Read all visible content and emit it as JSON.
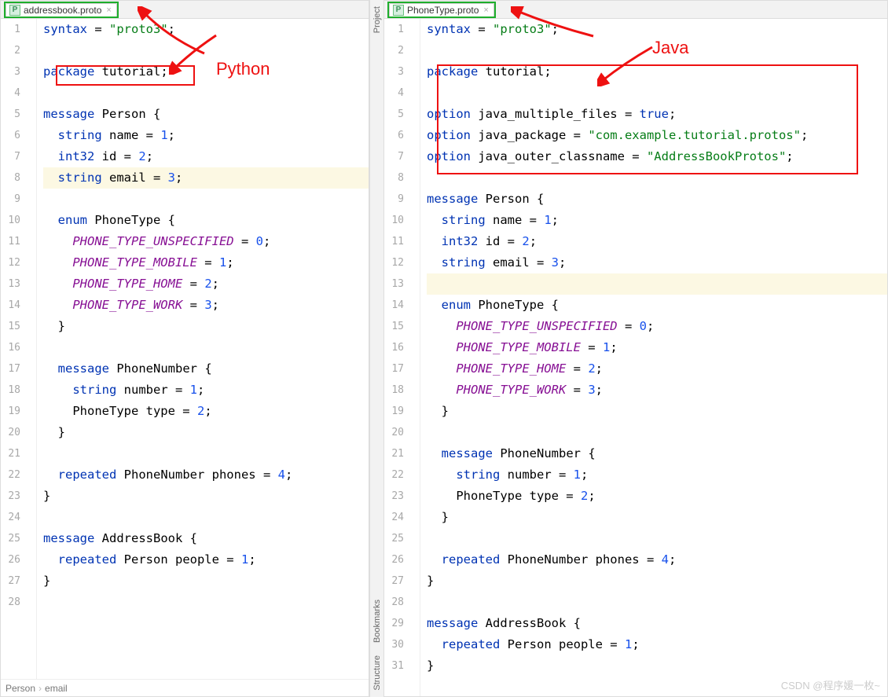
{
  "left": {
    "tab_name": "addressbook.proto",
    "tab_icon_letter": "P",
    "annotation": "Python",
    "breadcrumb": [
      "Person",
      "email"
    ],
    "lines": [
      {
        "n": 1,
        "html": "<span class='kw'>syntax</span> = <span class='str'>\"proto3\"</span>;"
      },
      {
        "n": 2,
        "html": ""
      },
      {
        "n": 3,
        "html": "<span class='kw'>package</span> tutorial;"
      },
      {
        "n": 4,
        "html": ""
      },
      {
        "n": 5,
        "html": "<span class='kw'>message</span> Person {"
      },
      {
        "n": 6,
        "html": "  <span class='kw'>string</span> name = <span class='num'>1</span>;"
      },
      {
        "n": 7,
        "html": "  <span class='kw'>int32</span> id = <span class='num'>2</span>;"
      },
      {
        "n": 8,
        "html": "  <span class='kw'>string</span> email = <span class='num'>3</span>;",
        "hl": true
      },
      {
        "n": 9,
        "html": ""
      },
      {
        "n": 10,
        "html": "  <span class='kw'>enum</span> PhoneType {"
      },
      {
        "n": 11,
        "html": "    <span class='enumv'>PHONE_TYPE_UNSPECIFIED</span> = <span class='num'>0</span>;"
      },
      {
        "n": 12,
        "html": "    <span class='enumv'>PHONE_TYPE_MOBILE</span> = <span class='num'>1</span>;"
      },
      {
        "n": 13,
        "html": "    <span class='enumv'>PHONE_TYPE_HOME</span> = <span class='num'>2</span>;"
      },
      {
        "n": 14,
        "html": "    <span class='enumv'>PHONE_TYPE_WORK</span> = <span class='num'>3</span>;"
      },
      {
        "n": 15,
        "html": "  }"
      },
      {
        "n": 16,
        "html": ""
      },
      {
        "n": 17,
        "html": "  <span class='kw'>message</span> PhoneNumber {"
      },
      {
        "n": 18,
        "html": "    <span class='kw'>string</span> number = <span class='num'>1</span>;"
      },
      {
        "n": 19,
        "html": "    PhoneType type = <span class='num'>2</span>;"
      },
      {
        "n": 20,
        "html": "  }"
      },
      {
        "n": 21,
        "html": ""
      },
      {
        "n": 22,
        "html": "  <span class='kw'>repeated</span> PhoneNumber phones = <span class='num'>4</span>;"
      },
      {
        "n": 23,
        "html": "}"
      },
      {
        "n": 24,
        "html": ""
      },
      {
        "n": 25,
        "html": "<span class='kw'>message</span> AddressBook {"
      },
      {
        "n": 26,
        "html": "  <span class='kw'>repeated</span> Person people = <span class='num'>1</span>;"
      },
      {
        "n": 27,
        "html": "}"
      },
      {
        "n": 28,
        "html": ""
      }
    ]
  },
  "right": {
    "tab_name": "PhoneType.proto",
    "tab_icon_letter": "P",
    "annotation": "Java",
    "side_tabs": {
      "project": "Project",
      "bookmarks": "Bookmarks",
      "structure": "Structure"
    },
    "lines": [
      {
        "n": 1,
        "html": "<span class='kw'>syntax</span> = <span class='str'>\"proto3\"</span>;"
      },
      {
        "n": 2,
        "html": ""
      },
      {
        "n": 3,
        "html": "<span class='kw'>package</span> tutorial;"
      },
      {
        "n": 4,
        "html": ""
      },
      {
        "n": 5,
        "html": "<span class='kw'>option</span> java_multiple_files = <span class='kw'>true</span>;"
      },
      {
        "n": 6,
        "html": "<span class='kw'>option</span> java_package = <span class='str'>\"com.example.tutorial.protos\"</span>;"
      },
      {
        "n": 7,
        "html": "<span class='kw'>option</span> java_outer_classname = <span class='str'>\"AddressBookProtos\"</span>;"
      },
      {
        "n": 8,
        "html": ""
      },
      {
        "n": 9,
        "html": "<span class='kw'>message</span> Person {"
      },
      {
        "n": 10,
        "html": "  <span class='kw'>string</span> name = <span class='num'>1</span>;"
      },
      {
        "n": 11,
        "html": "  <span class='kw'>int32</span> id = <span class='num'>2</span>;"
      },
      {
        "n": 12,
        "html": "  <span class='kw'>string</span> email = <span class='num'>3</span>;"
      },
      {
        "n": 13,
        "html": "",
        "hl": true
      },
      {
        "n": 14,
        "html": "  <span class='kw'>enum</span> PhoneType {"
      },
      {
        "n": 15,
        "html": "    <span class='enumv'>PHONE_TYPE_UNSPECIFIED</span> = <span class='num'>0</span>;"
      },
      {
        "n": 16,
        "html": "    <span class='enumv'>PHONE_TYPE_MOBILE</span> = <span class='num'>1</span>;"
      },
      {
        "n": 17,
        "html": "    <span class='enumv'>PHONE_TYPE_HOME</span> = <span class='num'>2</span>;"
      },
      {
        "n": 18,
        "html": "    <span class='enumv'>PHONE_TYPE_WORK</span> = <span class='num'>3</span>;"
      },
      {
        "n": 19,
        "html": "  }"
      },
      {
        "n": 20,
        "html": ""
      },
      {
        "n": 21,
        "html": "  <span class='kw'>message</span> PhoneNumber {"
      },
      {
        "n": 22,
        "html": "    <span class='kw'>string</span> number = <span class='num'>1</span>;"
      },
      {
        "n": 23,
        "html": "    PhoneType type = <span class='num'>2</span>;"
      },
      {
        "n": 24,
        "html": "  }"
      },
      {
        "n": 25,
        "html": ""
      },
      {
        "n": 26,
        "html": "  <span class='kw'>repeated</span> PhoneNumber phones = <span class='num'>4</span>;"
      },
      {
        "n": 27,
        "html": "}"
      },
      {
        "n": 28,
        "html": ""
      },
      {
        "n": 29,
        "html": "<span class='kw'>message</span> AddressBook {"
      },
      {
        "n": 30,
        "html": "  <span class='kw'>repeated</span> Person people = <span class='num'>1</span>;"
      },
      {
        "n": 31,
        "html": "}"
      }
    ]
  },
  "watermark": "CSDN @程序媛一枚~"
}
